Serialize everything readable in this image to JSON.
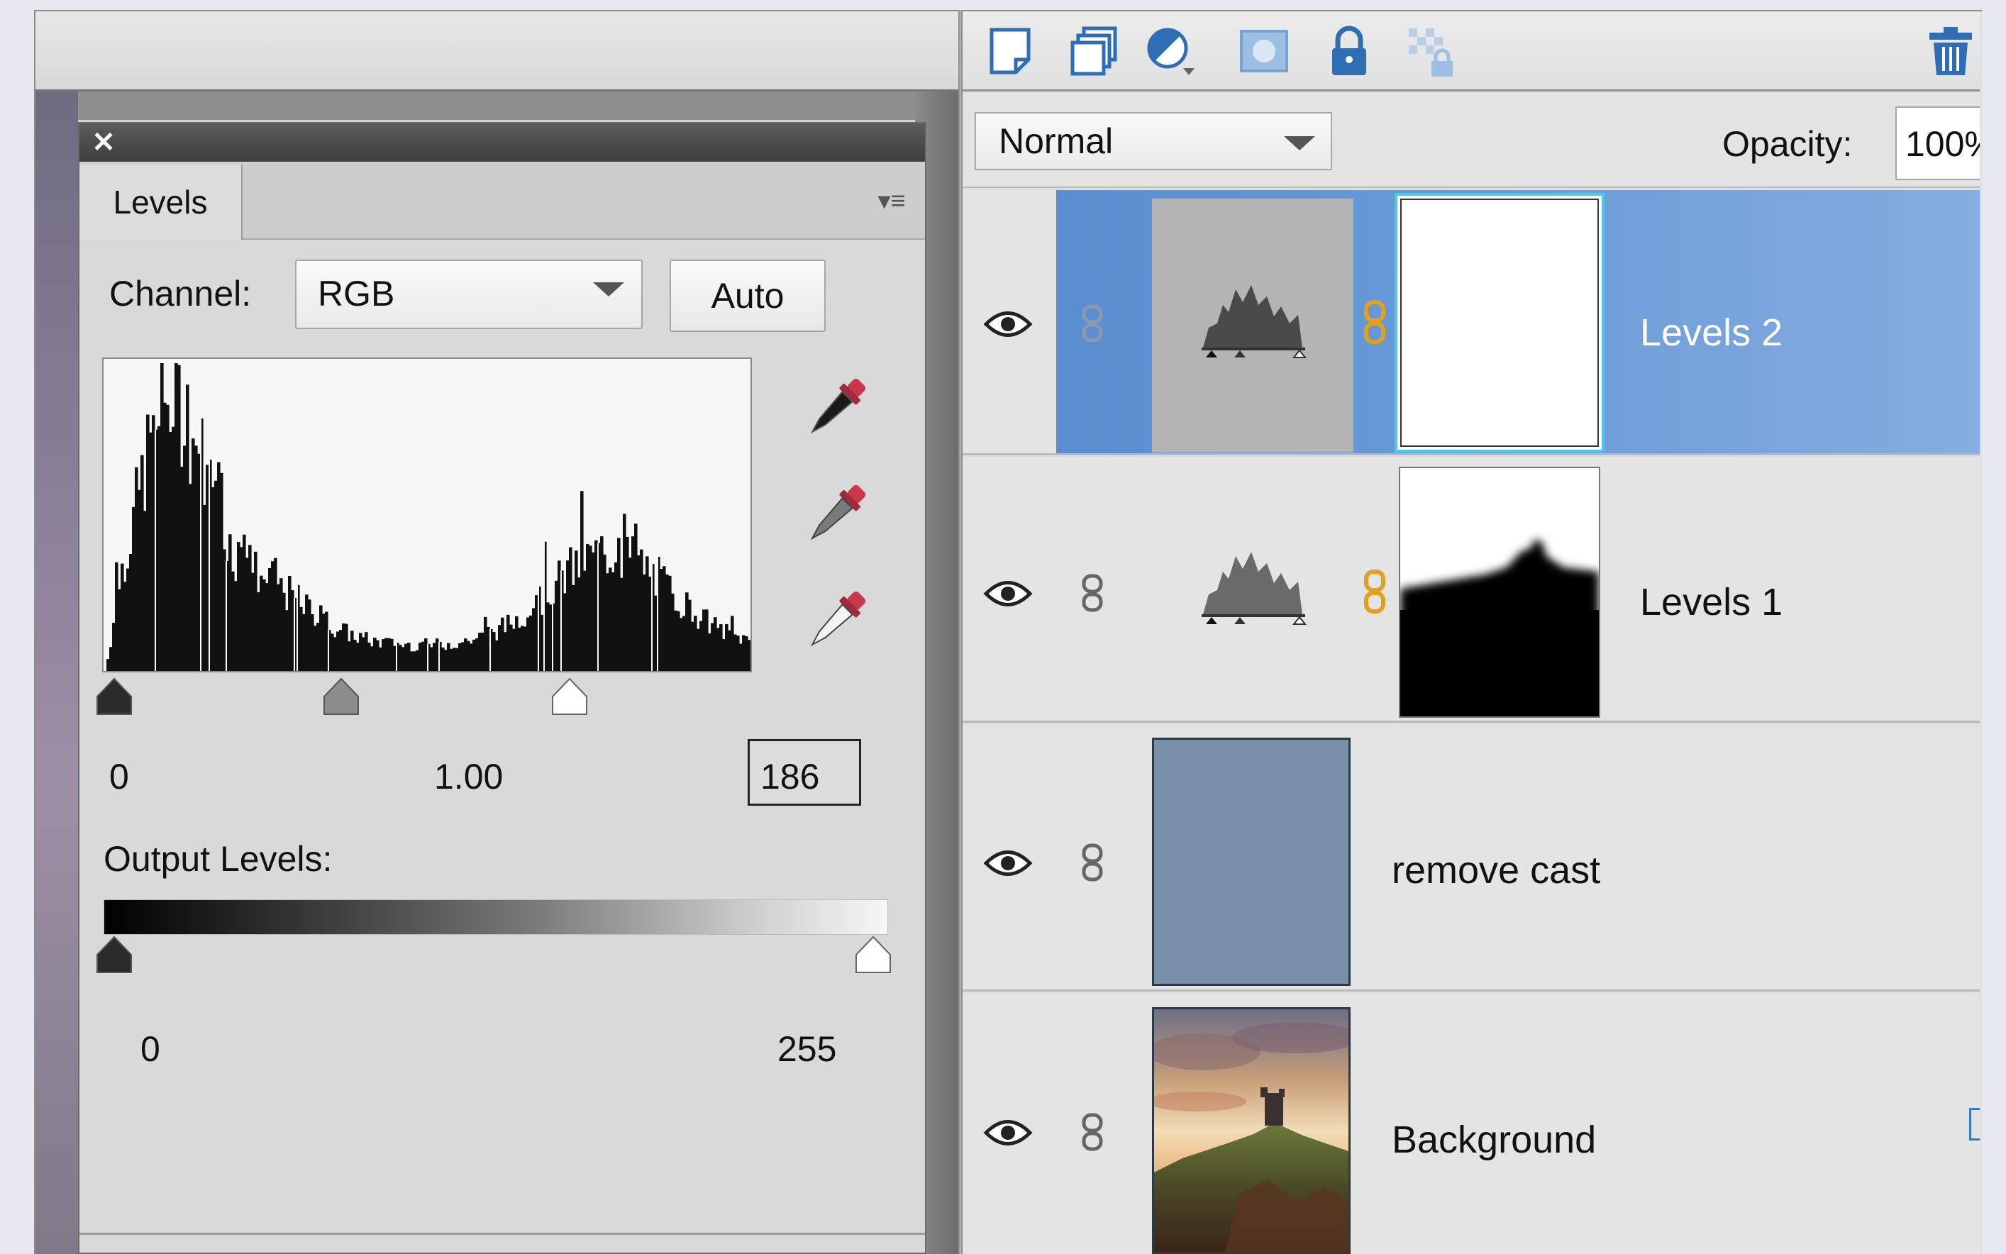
{
  "levels_panel": {
    "close_icon": "close-icon",
    "tab_label": "Levels",
    "channel_label": "Channel:",
    "channel_value": "RGB",
    "auto_label": "Auto",
    "input_black": "0",
    "input_gamma": "1.00",
    "input_white": "186",
    "output_label": "Output Levels:",
    "output_black": "0",
    "output_white": "255",
    "histogram_color": "#111111"
  },
  "layers_panel": {
    "toolbar_icons": [
      "new-layer-icon",
      "duplicate-layer-icon",
      "adjustment-layer-icon",
      "layer-mask-icon",
      "lock-icon",
      "lock-transparency-icon",
      "trash-icon"
    ],
    "blend_mode": "Normal",
    "opacity_label": "Opacity:",
    "opacity_value": "100%",
    "selected_color": "#5a8ed0",
    "layers": [
      {
        "name": "Levels 2",
        "selected": true
      },
      {
        "name": "Levels 1",
        "selected": false
      },
      {
        "name": "remove cast",
        "selected": false,
        "fill_color": "#7890a8"
      },
      {
        "name": "Background",
        "selected": false
      }
    ]
  }
}
